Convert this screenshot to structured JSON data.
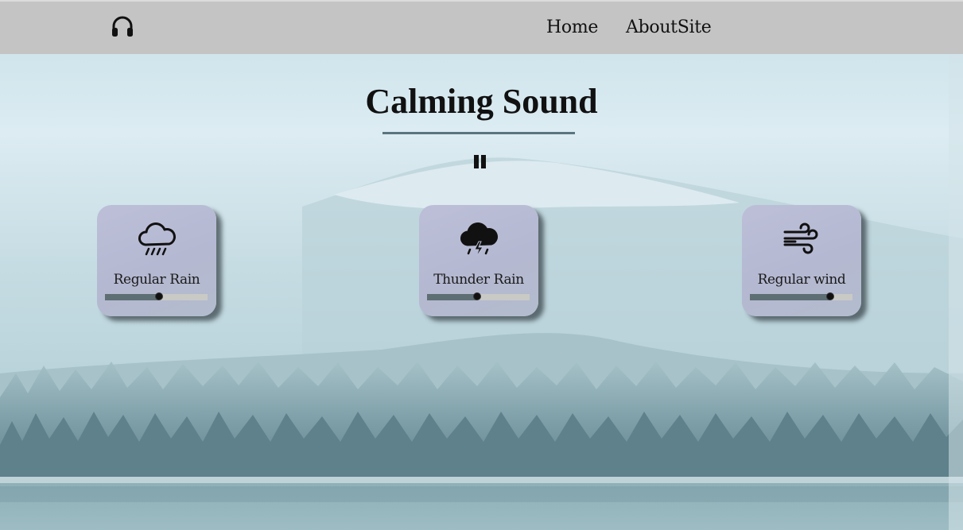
{
  "app": {
    "title": "Calming Sound"
  },
  "navbar": {
    "logo_icon": "headphones-icon",
    "links": [
      {
        "label": "Home"
      },
      {
        "label": "AboutSite"
      }
    ]
  },
  "player": {
    "pause_icon": "pause-icon"
  },
  "sounds": [
    {
      "label": "Regular Rain",
      "icon": "cloud-rain-icon",
      "volume": 0.53
    },
    {
      "label": "Thunder Rain",
      "icon": "cloud-lightning-rain-icon",
      "volume": 0.49
    },
    {
      "label": "Regular wind",
      "icon": "wind-icon",
      "volume": 0.78
    }
  ],
  "colors": {
    "navbar": "#c4c4c4",
    "card": "#b7bbd3",
    "slider_fill": "#5e6f74",
    "slider_track": "#c9c9c6",
    "underline": "#5a7580"
  }
}
